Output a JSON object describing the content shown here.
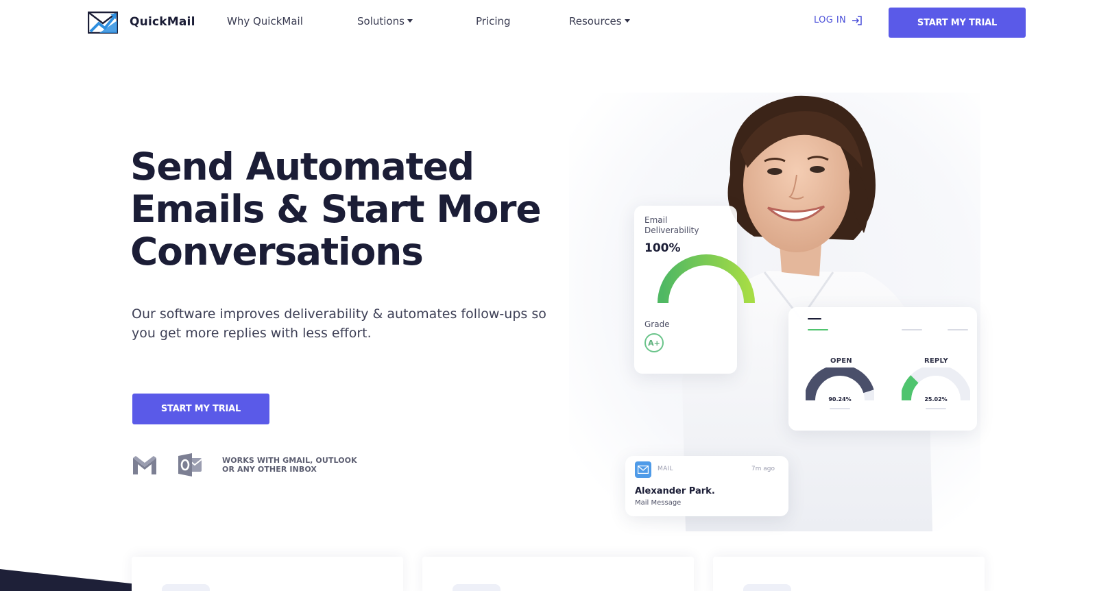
{
  "brand": {
    "name": "QuickMail"
  },
  "nav": {
    "items": [
      {
        "label": "Why QuickMail"
      },
      {
        "label": "Solutions"
      },
      {
        "label": "Pricing"
      },
      {
        "label": "Resources"
      }
    ],
    "login_label": "LOG IN",
    "cta_label": "START MY TRIAL"
  },
  "hero": {
    "title_lines": [
      "Send Automated",
      "Emails & Start More",
      "Conversations"
    ],
    "subtitle_lines": [
      "Our software improves deliverability & automates follow-ups so",
      "you get more replies with less effort."
    ],
    "cta_label": "START MY TRIAL",
    "works_with_lines": [
      "WORKS WITH GMAIL, OUTLOOK",
      "OR ANY OTHER INBOX"
    ],
    "works_with_icons": [
      "gmail-icon",
      "outlook-icon"
    ]
  },
  "deliverability_card": {
    "label_lines": [
      "Email",
      "Deliverability"
    ],
    "value": "100%",
    "grade_label": "Grade",
    "grade": "A+"
  },
  "stats_card": {
    "open_label": "OPEN",
    "open_value": "90.24%",
    "open_fraction": 0.9024,
    "reply_label": "REPLY",
    "reply_value": "25.02%",
    "reply_fraction": 0.2502
  },
  "mail_card": {
    "tag": "MAIL",
    "time": "7m ago",
    "sender": "Alexander Park.",
    "subject": "Mail Message"
  },
  "colors": {
    "primary": "#5a5ae8",
    "heading": "#1b1d36",
    "gauge_green": "#6ac94f",
    "open_gauge": "#4a4f6a",
    "reply_gauge": "#4fc46e"
  }
}
